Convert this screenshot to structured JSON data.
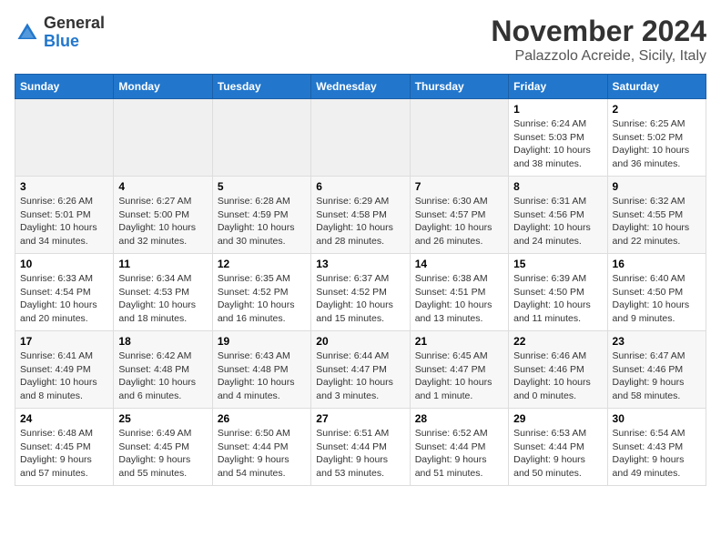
{
  "header": {
    "logo_general": "General",
    "logo_blue": "Blue",
    "month_title": "November 2024",
    "location": "Palazzolo Acreide, Sicily, Italy"
  },
  "calendar": {
    "days_of_week": [
      "Sunday",
      "Monday",
      "Tuesday",
      "Wednesday",
      "Thursday",
      "Friday",
      "Saturday"
    ],
    "weeks": [
      [
        {
          "day": "",
          "info": ""
        },
        {
          "day": "",
          "info": ""
        },
        {
          "day": "",
          "info": ""
        },
        {
          "day": "",
          "info": ""
        },
        {
          "day": "",
          "info": ""
        },
        {
          "day": "1",
          "info": "Sunrise: 6:24 AM\nSunset: 5:03 PM\nDaylight: 10 hours and 38 minutes."
        },
        {
          "day": "2",
          "info": "Sunrise: 6:25 AM\nSunset: 5:02 PM\nDaylight: 10 hours and 36 minutes."
        }
      ],
      [
        {
          "day": "3",
          "info": "Sunrise: 6:26 AM\nSunset: 5:01 PM\nDaylight: 10 hours and 34 minutes."
        },
        {
          "day": "4",
          "info": "Sunrise: 6:27 AM\nSunset: 5:00 PM\nDaylight: 10 hours and 32 minutes."
        },
        {
          "day": "5",
          "info": "Sunrise: 6:28 AM\nSunset: 4:59 PM\nDaylight: 10 hours and 30 minutes."
        },
        {
          "day": "6",
          "info": "Sunrise: 6:29 AM\nSunset: 4:58 PM\nDaylight: 10 hours and 28 minutes."
        },
        {
          "day": "7",
          "info": "Sunrise: 6:30 AM\nSunset: 4:57 PM\nDaylight: 10 hours and 26 minutes."
        },
        {
          "day": "8",
          "info": "Sunrise: 6:31 AM\nSunset: 4:56 PM\nDaylight: 10 hours and 24 minutes."
        },
        {
          "day": "9",
          "info": "Sunrise: 6:32 AM\nSunset: 4:55 PM\nDaylight: 10 hours and 22 minutes."
        }
      ],
      [
        {
          "day": "10",
          "info": "Sunrise: 6:33 AM\nSunset: 4:54 PM\nDaylight: 10 hours and 20 minutes."
        },
        {
          "day": "11",
          "info": "Sunrise: 6:34 AM\nSunset: 4:53 PM\nDaylight: 10 hours and 18 minutes."
        },
        {
          "day": "12",
          "info": "Sunrise: 6:35 AM\nSunset: 4:52 PM\nDaylight: 10 hours and 16 minutes."
        },
        {
          "day": "13",
          "info": "Sunrise: 6:37 AM\nSunset: 4:52 PM\nDaylight: 10 hours and 15 minutes."
        },
        {
          "day": "14",
          "info": "Sunrise: 6:38 AM\nSunset: 4:51 PM\nDaylight: 10 hours and 13 minutes."
        },
        {
          "day": "15",
          "info": "Sunrise: 6:39 AM\nSunset: 4:50 PM\nDaylight: 10 hours and 11 minutes."
        },
        {
          "day": "16",
          "info": "Sunrise: 6:40 AM\nSunset: 4:50 PM\nDaylight: 10 hours and 9 minutes."
        }
      ],
      [
        {
          "day": "17",
          "info": "Sunrise: 6:41 AM\nSunset: 4:49 PM\nDaylight: 10 hours and 8 minutes."
        },
        {
          "day": "18",
          "info": "Sunrise: 6:42 AM\nSunset: 4:48 PM\nDaylight: 10 hours and 6 minutes."
        },
        {
          "day": "19",
          "info": "Sunrise: 6:43 AM\nSunset: 4:48 PM\nDaylight: 10 hours and 4 minutes."
        },
        {
          "day": "20",
          "info": "Sunrise: 6:44 AM\nSunset: 4:47 PM\nDaylight: 10 hours and 3 minutes."
        },
        {
          "day": "21",
          "info": "Sunrise: 6:45 AM\nSunset: 4:47 PM\nDaylight: 10 hours and 1 minute."
        },
        {
          "day": "22",
          "info": "Sunrise: 6:46 AM\nSunset: 4:46 PM\nDaylight: 10 hours and 0 minutes."
        },
        {
          "day": "23",
          "info": "Sunrise: 6:47 AM\nSunset: 4:46 PM\nDaylight: 9 hours and 58 minutes."
        }
      ],
      [
        {
          "day": "24",
          "info": "Sunrise: 6:48 AM\nSunset: 4:45 PM\nDaylight: 9 hours and 57 minutes."
        },
        {
          "day": "25",
          "info": "Sunrise: 6:49 AM\nSunset: 4:45 PM\nDaylight: 9 hours and 55 minutes."
        },
        {
          "day": "26",
          "info": "Sunrise: 6:50 AM\nSunset: 4:44 PM\nDaylight: 9 hours and 54 minutes."
        },
        {
          "day": "27",
          "info": "Sunrise: 6:51 AM\nSunset: 4:44 PM\nDaylight: 9 hours and 53 minutes."
        },
        {
          "day": "28",
          "info": "Sunrise: 6:52 AM\nSunset: 4:44 PM\nDaylight: 9 hours and 51 minutes."
        },
        {
          "day": "29",
          "info": "Sunrise: 6:53 AM\nSunset: 4:44 PM\nDaylight: 9 hours and 50 minutes."
        },
        {
          "day": "30",
          "info": "Sunrise: 6:54 AM\nSunset: 4:43 PM\nDaylight: 9 hours and 49 minutes."
        }
      ]
    ]
  }
}
